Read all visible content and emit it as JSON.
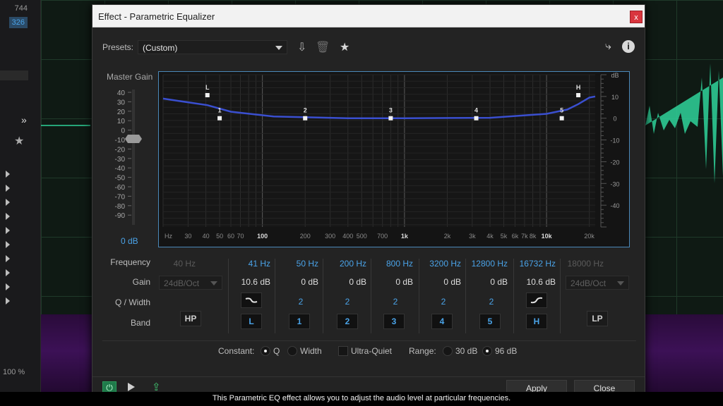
{
  "background": {
    "left_numbers": [
      "744",
      "326"
    ],
    "zoom_readout": "100 %"
  },
  "dialog": {
    "title": "Effect - Parametric Equalizer",
    "close_label": "x",
    "presets_label": "Presets:",
    "preset_value": "(Custom)",
    "icons": [
      "save-preset-icon",
      "delete-preset-icon",
      "favorite-star-icon",
      "route-icon",
      "info-icon"
    ]
  },
  "graph": {
    "master_gain_label": "Master Gain",
    "master_gain_value": "0 dB",
    "master_ticks": [
      "40",
      "30",
      "20",
      "10",
      "0",
      "-10",
      "-20",
      "-30",
      "-40",
      "-50",
      "-60",
      "-70",
      "-80",
      "-90"
    ],
    "right_ticks": [
      "dB",
      "10",
      "0",
      "-10",
      "-20",
      "-30",
      "-40"
    ],
    "freq_ticks": [
      "Hz",
      "30",
      "40",
      "50",
      "60",
      "70",
      "100",
      "200",
      "300",
      "400",
      "500",
      "700",
      "1k",
      "2k",
      "3k",
      "4k",
      "5k",
      "6k",
      "7k",
      "8k",
      "10k",
      "20k"
    ],
    "node_labels": [
      "L",
      "1",
      "2",
      "3",
      "4",
      "5",
      "H"
    ]
  },
  "rows": {
    "frequency_label": "Frequency",
    "gain_label": "Gain",
    "q_label": "Q / Width",
    "band_label": "Band"
  },
  "bands": [
    {
      "freq": "40 Hz",
      "gain": "24dB/Oct",
      "q": "",
      "band": "HP",
      "state": "disabled"
    },
    {
      "freq": "41 Hz",
      "gain": "10.6 dB",
      "q": "~",
      "band": "L",
      "state": "active"
    },
    {
      "freq": "50 Hz",
      "gain": "0 dB",
      "q": "2",
      "band": "1",
      "state": "active"
    },
    {
      "freq": "200 Hz",
      "gain": "0 dB",
      "q": "2",
      "band": "2",
      "state": "active"
    },
    {
      "freq": "800 Hz",
      "gain": "0 dB",
      "q": "2",
      "band": "3",
      "state": "active"
    },
    {
      "freq": "3200 Hz",
      "gain": "0 dB",
      "q": "2",
      "band": "4",
      "state": "active"
    },
    {
      "freq": "12800 Hz",
      "gain": "0 dB",
      "q": "2",
      "band": "5",
      "state": "active"
    },
    {
      "freq": "16732 Hz",
      "gain": "10.6 dB",
      "q": "~",
      "band": "H",
      "state": "active"
    },
    {
      "freq": "18000 Hz",
      "gain": "24dB/Oct",
      "q": "",
      "band": "LP",
      "state": "disabled"
    }
  ],
  "options": {
    "constant_label": "Constant:",
    "q_label": "Q",
    "width_label": "Width",
    "ultra_quiet_label": "Ultra-Quiet",
    "range_label": "Range:",
    "range_30": "30 dB",
    "range_96": "96 dB"
  },
  "footer": {
    "apply_label": "Apply",
    "close_label": "Close"
  },
  "caption": "This Parametric EQ effect allows you to adjust the audio level at particular frequencies.",
  "colors": {
    "accent": "#4aa3e8",
    "curve": "#3a4fd0",
    "waveform": "#2fd39a"
  }
}
